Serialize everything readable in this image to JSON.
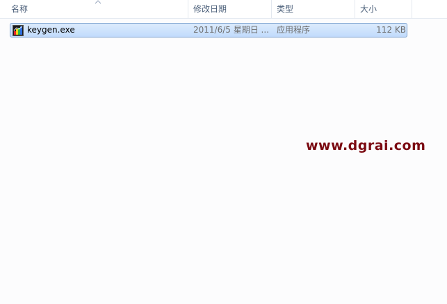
{
  "columns": {
    "name": "名称",
    "date_modified": "修改日期",
    "type": "类型",
    "size": "大小"
  },
  "sort": {
    "column": "name",
    "icon": "sort-up-arrow-icon"
  },
  "files": [
    {
      "name": "keygen.exe",
      "date_modified": "2011/6/5 星期日 ...",
      "type": "应用程序",
      "size": "112 KB",
      "icon": "exe-application-icon",
      "selected": true
    }
  ],
  "watermark": "www.dgrai.com",
  "colors": {
    "selection_border": "#7da2ce",
    "selection_fill": "#cde3fc",
    "header_text": "#4c607a",
    "watermark": "#7b0a12"
  }
}
